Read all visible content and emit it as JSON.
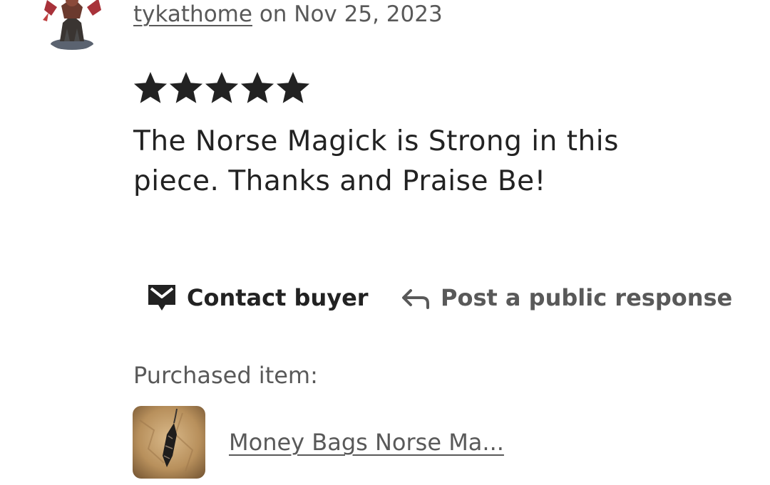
{
  "review": {
    "username": "tykathome",
    "date_text": "on Nov 25, 2023",
    "rating": 5,
    "text": "The Norse Magick is Strong in this piece. Thanks and Praise Be!",
    "avatar_icon": "warrior-figure-avatar"
  },
  "actions": {
    "contact_label": "Contact buyer",
    "contact_icon": "mail-icon",
    "respond_label": "Post a public response",
    "respond_icon": "reply-arrow-icon"
  },
  "purchase": {
    "label": "Purchased item:",
    "item_title": "Money Bags Norse Ma...",
    "thumb_icon": "pendant-product-thumbnail"
  },
  "colors": {
    "text_primary": "#222222",
    "text_secondary": "#595959",
    "star": "#222222"
  }
}
